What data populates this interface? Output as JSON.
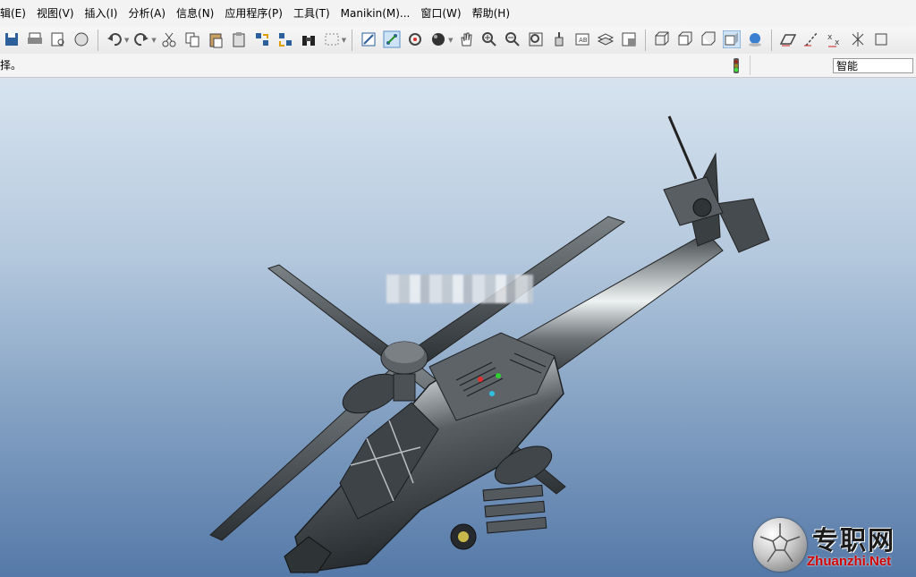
{
  "menu": {
    "items": [
      "辑(E)",
      "视图(V)",
      "插入(I)",
      "分析(A)",
      "信息(N)",
      "应用程序(P)",
      "工具(T)",
      "Manikin(M)...",
      "窗口(W)",
      "帮助(H)"
    ]
  },
  "toolbar": {
    "buttons": [
      {
        "name": "save-icon"
      },
      {
        "name": "print-icon"
      },
      {
        "name": "print-preview-icon"
      },
      {
        "name": "cut-shape-icon"
      },
      {
        "sep": true
      },
      {
        "name": "undo-icon",
        "drop": true
      },
      {
        "name": "redo-icon",
        "drop": true
      },
      {
        "name": "scissors-icon"
      },
      {
        "name": "copy-icon"
      },
      {
        "name": "paste-icon"
      },
      {
        "name": "paste-special-icon"
      },
      {
        "name": "regenerate-icon"
      },
      {
        "name": "regenerate-manager-icon"
      },
      {
        "name": "binoculars-icon"
      },
      {
        "name": "select-box-icon",
        "drop": true
      },
      {
        "sep": true
      },
      {
        "name": "repaint-icon"
      },
      {
        "name": "spin-center-icon"
      },
      {
        "name": "orient-mode-icon"
      },
      {
        "name": "appearance-sphere-icon",
        "drop": true
      },
      {
        "name": "pan-hand-icon"
      },
      {
        "name": "zoom-in-icon"
      },
      {
        "name": "zoom-out-icon"
      },
      {
        "name": "refit-icon"
      },
      {
        "name": "reorient-icon"
      },
      {
        "name": "saved-views-icon"
      },
      {
        "name": "layers-icon"
      },
      {
        "name": "view-manager-icon"
      },
      {
        "sep": true
      },
      {
        "name": "wireframe-icon"
      },
      {
        "name": "hidden-line-icon"
      },
      {
        "name": "no-hidden-icon"
      },
      {
        "name": "shading-icon"
      },
      {
        "name": "model-tree-globe-icon"
      },
      {
        "sep": true
      },
      {
        "name": "datum-plane-icon"
      },
      {
        "name": "datum-axis-icon"
      },
      {
        "name": "datum-point-icon"
      },
      {
        "name": "csys-icon"
      },
      {
        "name": "more-datum-icon"
      }
    ]
  },
  "status": {
    "message": "择。"
  },
  "filter": {
    "value": "智能"
  },
  "watermark": {
    "cn": "专职网",
    "en": "Zhuanzhi.Net"
  },
  "colors": {
    "viewport_top": "#d7e3ef",
    "viewport_bottom": "#5579a8",
    "model": "#4f5559",
    "watermark_red": "#d00000"
  }
}
